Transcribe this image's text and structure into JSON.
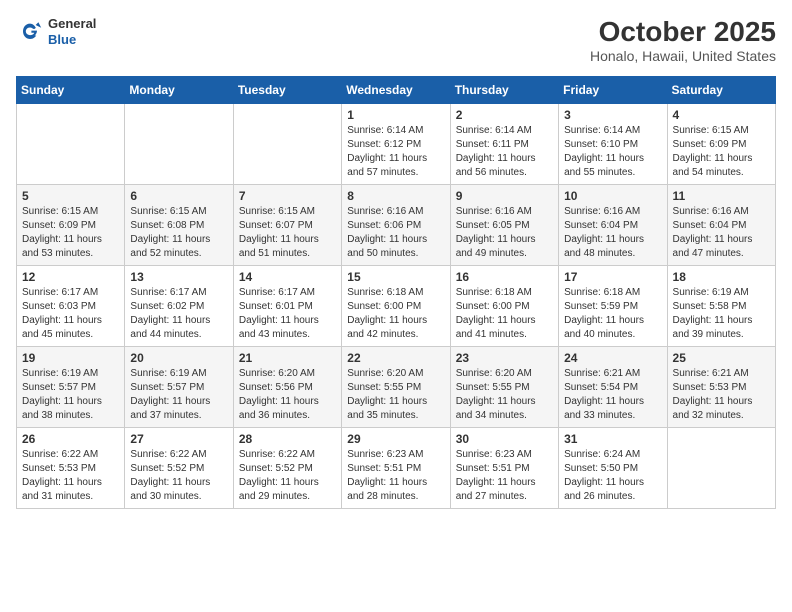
{
  "header": {
    "logo_general": "General",
    "logo_blue": "Blue",
    "month": "October 2025",
    "location": "Honalo, Hawaii, United States"
  },
  "days_of_week": [
    "Sunday",
    "Monday",
    "Tuesday",
    "Wednesday",
    "Thursday",
    "Friday",
    "Saturday"
  ],
  "weeks": [
    [
      {
        "day": "",
        "sunrise": "",
        "sunset": "",
        "daylight": ""
      },
      {
        "day": "",
        "sunrise": "",
        "sunset": "",
        "daylight": ""
      },
      {
        "day": "",
        "sunrise": "",
        "sunset": "",
        "daylight": ""
      },
      {
        "day": "1",
        "sunrise": "Sunrise: 6:14 AM",
        "sunset": "Sunset: 6:12 PM",
        "daylight": "Daylight: 11 hours and 57 minutes."
      },
      {
        "day": "2",
        "sunrise": "Sunrise: 6:14 AM",
        "sunset": "Sunset: 6:11 PM",
        "daylight": "Daylight: 11 hours and 56 minutes."
      },
      {
        "day": "3",
        "sunrise": "Sunrise: 6:14 AM",
        "sunset": "Sunset: 6:10 PM",
        "daylight": "Daylight: 11 hours and 55 minutes."
      },
      {
        "day": "4",
        "sunrise": "Sunrise: 6:15 AM",
        "sunset": "Sunset: 6:09 PM",
        "daylight": "Daylight: 11 hours and 54 minutes."
      }
    ],
    [
      {
        "day": "5",
        "sunrise": "Sunrise: 6:15 AM",
        "sunset": "Sunset: 6:09 PM",
        "daylight": "Daylight: 11 hours and 53 minutes."
      },
      {
        "day": "6",
        "sunrise": "Sunrise: 6:15 AM",
        "sunset": "Sunset: 6:08 PM",
        "daylight": "Daylight: 11 hours and 52 minutes."
      },
      {
        "day": "7",
        "sunrise": "Sunrise: 6:15 AM",
        "sunset": "Sunset: 6:07 PM",
        "daylight": "Daylight: 11 hours and 51 minutes."
      },
      {
        "day": "8",
        "sunrise": "Sunrise: 6:16 AM",
        "sunset": "Sunset: 6:06 PM",
        "daylight": "Daylight: 11 hours and 50 minutes."
      },
      {
        "day": "9",
        "sunrise": "Sunrise: 6:16 AM",
        "sunset": "Sunset: 6:05 PM",
        "daylight": "Daylight: 11 hours and 49 minutes."
      },
      {
        "day": "10",
        "sunrise": "Sunrise: 6:16 AM",
        "sunset": "Sunset: 6:04 PM",
        "daylight": "Daylight: 11 hours and 48 minutes."
      },
      {
        "day": "11",
        "sunrise": "Sunrise: 6:16 AM",
        "sunset": "Sunset: 6:04 PM",
        "daylight": "Daylight: 11 hours and 47 minutes."
      }
    ],
    [
      {
        "day": "12",
        "sunrise": "Sunrise: 6:17 AM",
        "sunset": "Sunset: 6:03 PM",
        "daylight": "Daylight: 11 hours and 45 minutes."
      },
      {
        "day": "13",
        "sunrise": "Sunrise: 6:17 AM",
        "sunset": "Sunset: 6:02 PM",
        "daylight": "Daylight: 11 hours and 44 minutes."
      },
      {
        "day": "14",
        "sunrise": "Sunrise: 6:17 AM",
        "sunset": "Sunset: 6:01 PM",
        "daylight": "Daylight: 11 hours and 43 minutes."
      },
      {
        "day": "15",
        "sunrise": "Sunrise: 6:18 AM",
        "sunset": "Sunset: 6:00 PM",
        "daylight": "Daylight: 11 hours and 42 minutes."
      },
      {
        "day": "16",
        "sunrise": "Sunrise: 6:18 AM",
        "sunset": "Sunset: 6:00 PM",
        "daylight": "Daylight: 11 hours and 41 minutes."
      },
      {
        "day": "17",
        "sunrise": "Sunrise: 6:18 AM",
        "sunset": "Sunset: 5:59 PM",
        "daylight": "Daylight: 11 hours and 40 minutes."
      },
      {
        "day": "18",
        "sunrise": "Sunrise: 6:19 AM",
        "sunset": "Sunset: 5:58 PM",
        "daylight": "Daylight: 11 hours and 39 minutes."
      }
    ],
    [
      {
        "day": "19",
        "sunrise": "Sunrise: 6:19 AM",
        "sunset": "Sunset: 5:57 PM",
        "daylight": "Daylight: 11 hours and 38 minutes."
      },
      {
        "day": "20",
        "sunrise": "Sunrise: 6:19 AM",
        "sunset": "Sunset: 5:57 PM",
        "daylight": "Daylight: 11 hours and 37 minutes."
      },
      {
        "day": "21",
        "sunrise": "Sunrise: 6:20 AM",
        "sunset": "Sunset: 5:56 PM",
        "daylight": "Daylight: 11 hours and 36 minutes."
      },
      {
        "day": "22",
        "sunrise": "Sunrise: 6:20 AM",
        "sunset": "Sunset: 5:55 PM",
        "daylight": "Daylight: 11 hours and 35 minutes."
      },
      {
        "day": "23",
        "sunrise": "Sunrise: 6:20 AM",
        "sunset": "Sunset: 5:55 PM",
        "daylight": "Daylight: 11 hours and 34 minutes."
      },
      {
        "day": "24",
        "sunrise": "Sunrise: 6:21 AM",
        "sunset": "Sunset: 5:54 PM",
        "daylight": "Daylight: 11 hours and 33 minutes."
      },
      {
        "day": "25",
        "sunrise": "Sunrise: 6:21 AM",
        "sunset": "Sunset: 5:53 PM",
        "daylight": "Daylight: 11 hours and 32 minutes."
      }
    ],
    [
      {
        "day": "26",
        "sunrise": "Sunrise: 6:22 AM",
        "sunset": "Sunset: 5:53 PM",
        "daylight": "Daylight: 11 hours and 31 minutes."
      },
      {
        "day": "27",
        "sunrise": "Sunrise: 6:22 AM",
        "sunset": "Sunset: 5:52 PM",
        "daylight": "Daylight: 11 hours and 30 minutes."
      },
      {
        "day": "28",
        "sunrise": "Sunrise: 6:22 AM",
        "sunset": "Sunset: 5:52 PM",
        "daylight": "Daylight: 11 hours and 29 minutes."
      },
      {
        "day": "29",
        "sunrise": "Sunrise: 6:23 AM",
        "sunset": "Sunset: 5:51 PM",
        "daylight": "Daylight: 11 hours and 28 minutes."
      },
      {
        "day": "30",
        "sunrise": "Sunrise: 6:23 AM",
        "sunset": "Sunset: 5:51 PM",
        "daylight": "Daylight: 11 hours and 27 minutes."
      },
      {
        "day": "31",
        "sunrise": "Sunrise: 6:24 AM",
        "sunset": "Sunset: 5:50 PM",
        "daylight": "Daylight: 11 hours and 26 minutes."
      },
      {
        "day": "",
        "sunrise": "",
        "sunset": "",
        "daylight": ""
      }
    ]
  ]
}
